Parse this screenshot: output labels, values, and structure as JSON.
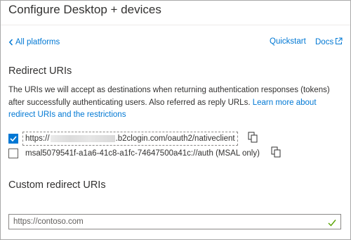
{
  "title": "Configure Desktop + devices",
  "nav": {
    "back_label": "All platforms",
    "quickstart": "Quickstart",
    "docs": "Docs"
  },
  "redirect": {
    "heading": "Redirect URIs",
    "description": "The URIs we will accept as destinations when returning authentication responses (tokens) after successfully authenticating users. Also referred as reply URLs.",
    "learn_more": "Learn more about redirect URIs and the restrictions",
    "uris": [
      {
        "prefix": "https://",
        "suffix": ".b2clogin.com/oauth2/nativeclient",
        "checked": true
      },
      {
        "value": "msal5079541f-a1a6-41c8-a1fc-74647500a41c://auth (MSAL only)",
        "checked": false
      }
    ]
  },
  "custom": {
    "heading": "Custom redirect URIs",
    "placeholder": "https://contoso.com"
  },
  "colors": {
    "accent": "#0078d4",
    "success": "#57a300",
    "text": "#323130"
  }
}
